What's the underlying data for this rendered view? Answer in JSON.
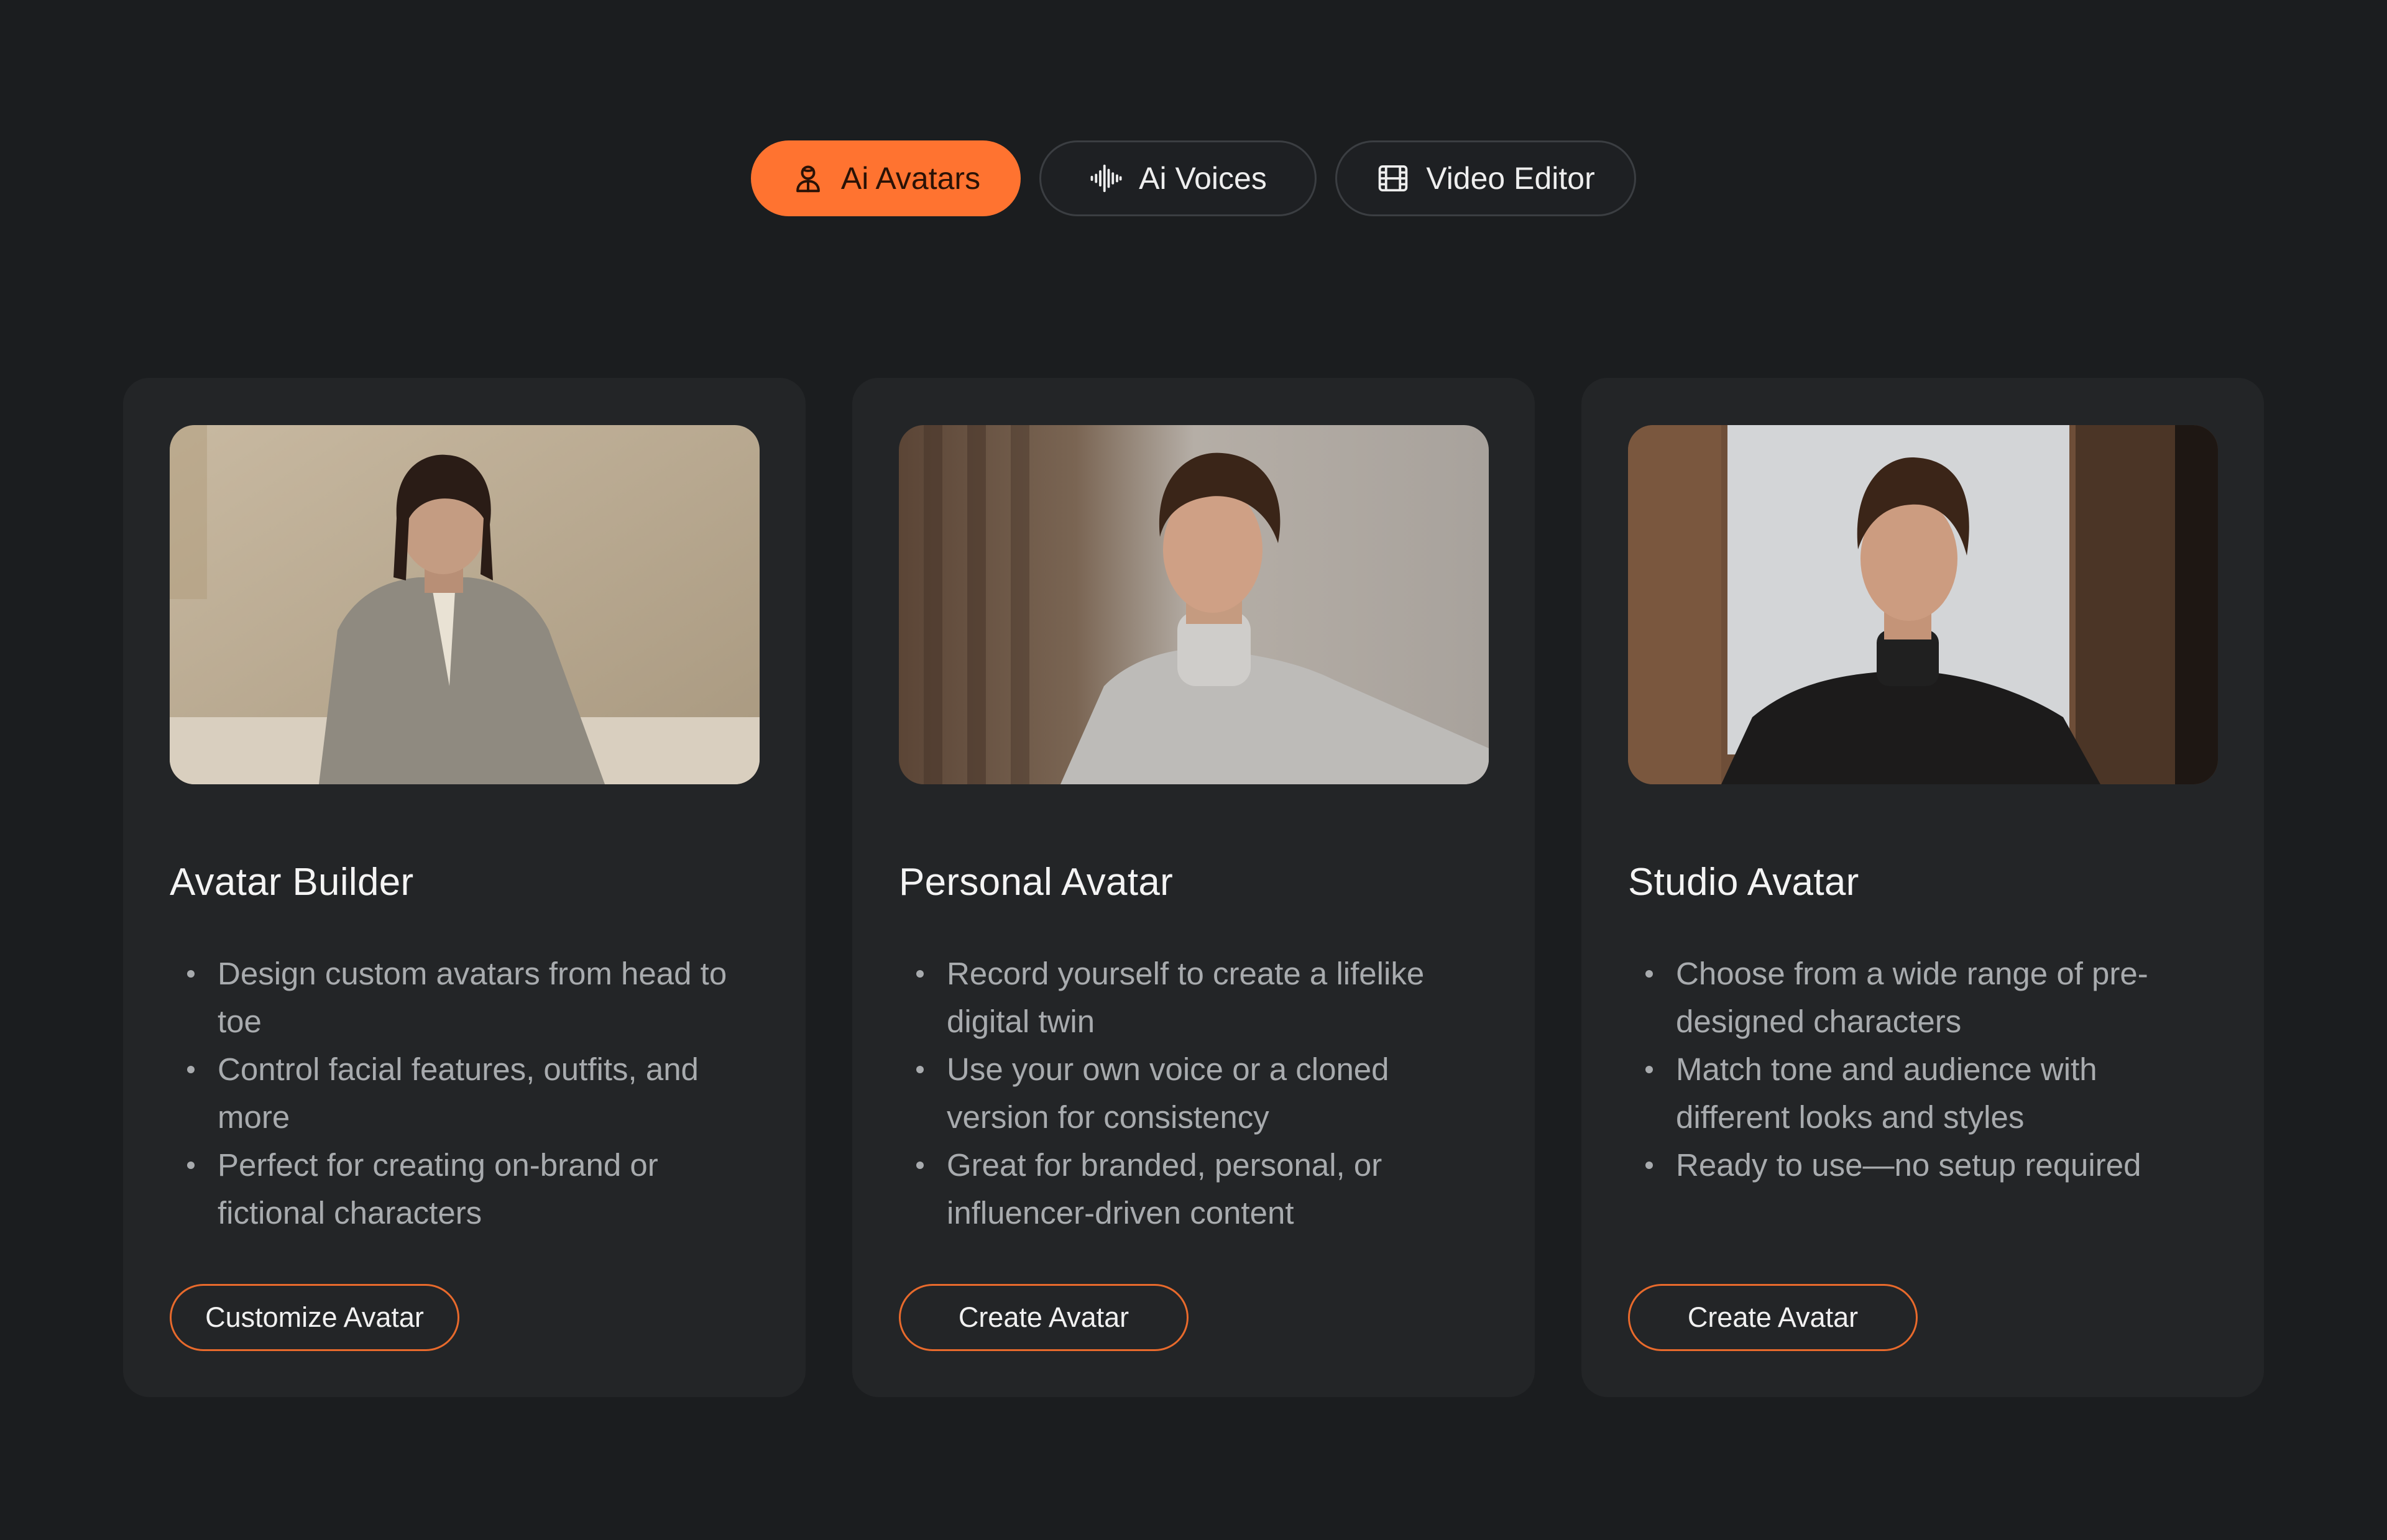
{
  "tabs": [
    {
      "label": "Ai Avatars",
      "icon": "avatar-icon",
      "active": true
    },
    {
      "label": "Ai Voices",
      "icon": "waveform-icon",
      "active": false
    },
    {
      "label": "Video Editor",
      "icon": "film-icon",
      "active": false
    }
  ],
  "cards": [
    {
      "title": "Avatar Builder",
      "bullets": [
        "Design custom avatars from head to toe",
        "Control facial features, outfits, and more",
        "Perfect for creating on-brand or fictional characters"
      ],
      "cta": "Customize Avatar"
    },
    {
      "title": "Personal Avatar",
      "bullets": [
        "Record yourself to create a lifelike digital twin",
        "Use your own voice or a cloned version for consistency",
        "Great for branded, personal, or influencer-driven content"
      ],
      "cta": "Create Avatar"
    },
    {
      "title": "Studio Avatar",
      "bullets": [
        "Choose from a wide range of pre-designed characters",
        "Match tone and audience with different looks and styles",
        "Ready to use—no setup required"
      ],
      "cta": "Create Avatar"
    }
  ],
  "colors": {
    "background": "#1b1d1f",
    "card": "#232527",
    "accent": "#ff7330",
    "button_border": "#e86a2c",
    "muted_text": "#a8abae"
  }
}
